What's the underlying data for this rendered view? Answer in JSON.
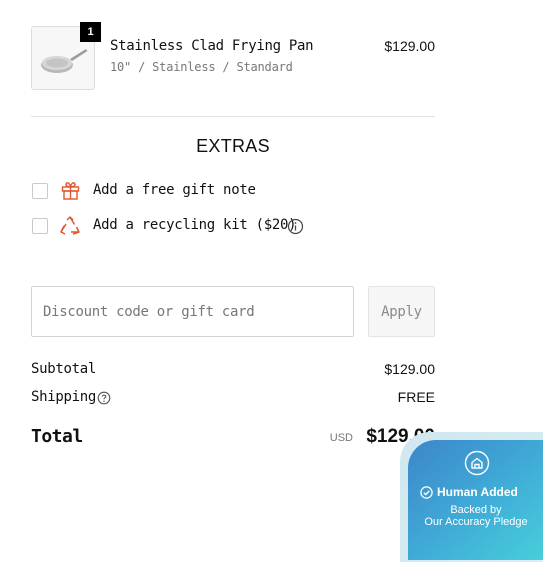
{
  "cart_item": {
    "quantity": "1",
    "name": "Stainless Clad Frying Pan",
    "variant": "10\" / Stainless / Standard",
    "price": "$129.00",
    "thumbnail_icon": "frying-pan-icon"
  },
  "extras": {
    "title": "EXTRAS",
    "options": [
      {
        "label": "Add a free gift note",
        "icon": "gift-icon",
        "checked": false
      },
      {
        "label": "Add a recycling kit ($20)",
        "icon": "recycle-icon",
        "checked": false,
        "info_icon": "info-icon"
      }
    ]
  },
  "discount": {
    "placeholder": "Discount code or gift card",
    "value": "",
    "apply_label": "Apply"
  },
  "summary": {
    "subtotal_label": "Subtotal",
    "subtotal_value": "$129.00",
    "shipping_label": "Shipping",
    "shipping_value": "FREE",
    "total_label": "Total",
    "currency": "USD",
    "total_value": "$129.00"
  },
  "badge": {
    "title": "Human Added",
    "line1": "Backed by",
    "line2": "Our Accuracy Pledge",
    "icon": "shield-home-icon"
  },
  "colors": {
    "accent_orange": "#e2552e",
    "badge_start": "#3c86c9",
    "badge_end": "#48d2dc"
  }
}
